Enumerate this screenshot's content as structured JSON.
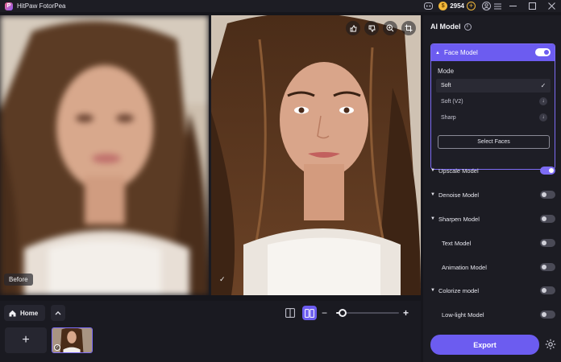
{
  "titlebar": {
    "app_title": "HitPaw FotorPea",
    "coins": "2954",
    "coin_glyph": "$",
    "plus": "+"
  },
  "canvas": {
    "before_label": "Before",
    "after_check": "✓"
  },
  "bottom": {
    "home_label": "Home",
    "zoom_level": 0.1,
    "add_label": "+"
  },
  "panel": {
    "title": "AI Model",
    "face_model": {
      "label": "Face Model",
      "enabled": true,
      "mode_label": "Mode",
      "modes": [
        {
          "label": "Soft",
          "state": "selected"
        },
        {
          "label": "Soft (V2)",
          "state": "download"
        },
        {
          "label": "Sharp",
          "state": "download"
        }
      ],
      "select_faces": "Select Faces"
    },
    "models": [
      {
        "label": "Upscale Model",
        "expandable": true,
        "enabled": true
      },
      {
        "label": "Denoise Model",
        "expandable": true,
        "enabled": false
      },
      {
        "label": "Sharpen Model",
        "expandable": true,
        "enabled": false
      },
      {
        "label": "Text Model",
        "expandable": false,
        "enabled": false
      },
      {
        "label": "Animation Model",
        "expandable": false,
        "enabled": false
      },
      {
        "label": "Colorize model",
        "expandable": true,
        "enabled": false
      },
      {
        "label": "Low-light Model",
        "expandable": false,
        "enabled": false
      }
    ],
    "export_label": "Export"
  },
  "colors": {
    "accent": "#6c5cf0",
    "background": "#16161c",
    "coin": "#f2b83a"
  }
}
